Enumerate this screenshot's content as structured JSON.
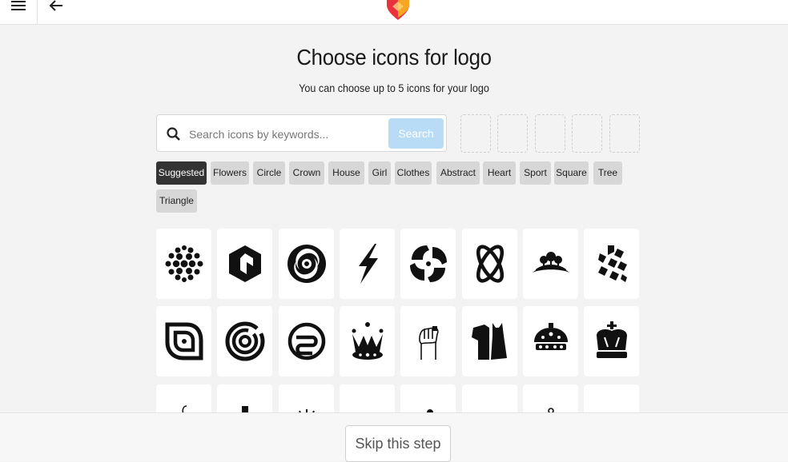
{
  "header": {
    "menu_icon": "hamburger-icon",
    "back_icon": "arrow-left-icon",
    "logo_colors": [
      "#f6a623",
      "#e8323c"
    ]
  },
  "main": {
    "title": "Choose icons for logo",
    "subtitle": "You can choose up to 5 icons for your logo"
  },
  "search": {
    "placeholder": "Search icons by keywords...",
    "button_label": "Search",
    "button_color": "#b9dcf6"
  },
  "selected_slots_count": 5,
  "categories": [
    "Suggested",
    "Flowers",
    "Circle",
    "Crown",
    "House",
    "Girl",
    "Clothes",
    "Abstract",
    "Heart",
    "Sport",
    "Square",
    "Tree",
    "Triangle"
  ],
  "active_category": "Suggested",
  "icons": [
    "dotted-sphere-icon",
    "hexagon-arrow-icon",
    "swirl-icon",
    "lightning-bolt-icon",
    "pinwheel-icon",
    "atom-ellipse-icon",
    "trees-hill-icon",
    "puzzle-cubes-icon",
    "square-spiral-icon",
    "circular-maze-icon",
    "circle-s-icon",
    "jeweled-crown-icon",
    "raised-fist-icon",
    "dress-shirt-icon",
    "ornate-crown-icon",
    "royal-crown-icon",
    "woman-sketch-icon",
    "cross-shape-icon",
    "sunburst-icon",
    "tiara-icon",
    "person-silhouette-icon",
    "circle-swoosh-icon",
    "crown-outline-icon",
    "hand-sketch-icon"
  ],
  "footer": {
    "skip_label": "Skip this step"
  }
}
